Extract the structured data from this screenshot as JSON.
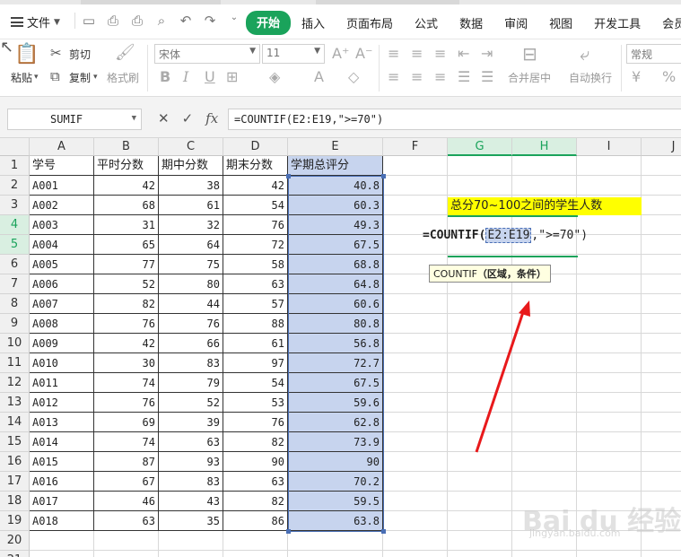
{
  "menubar": {
    "file_label": "文件",
    "tabs": [
      "开始",
      "插入",
      "页面布局",
      "公式",
      "数据",
      "审阅",
      "视图",
      "开发工具",
      "会员专"
    ],
    "active_tab": "开始"
  },
  "ribbon": {
    "paste_label": "粘贴",
    "cut_label": "剪切",
    "copy_label": "复制",
    "format_painter_label": "格式刷",
    "font_name": "宋体",
    "font_size": "11",
    "merge_label": "合并居中",
    "wrap_label": "自动换行",
    "number_format": "常规",
    "currency_symbol": "¥",
    "percent_symbol": "%"
  },
  "formula_bar": {
    "name_box": "SUMIF",
    "formula": "=COUNTIF(E2:E19,\">=70\")"
  },
  "columns": [
    "A",
    "B",
    "C",
    "D",
    "E",
    "F",
    "G",
    "H",
    "I",
    "J"
  ],
  "rows": [
    "1",
    "2",
    "3",
    "4",
    "5",
    "6",
    "7",
    "8",
    "9",
    "10",
    "11",
    "12",
    "13",
    "14",
    "15",
    "16",
    "17",
    "18",
    "19",
    "20",
    "21"
  ],
  "table": {
    "headers": [
      "学号",
      "平时分数",
      "期中分数",
      "期末分数",
      "学期总评分"
    ],
    "rows": [
      [
        "A001",
        "42",
        "38",
        "42",
        "40.8"
      ],
      [
        "A002",
        "68",
        "61",
        "54",
        "60.3"
      ],
      [
        "A003",
        "31",
        "32",
        "76",
        "49.3"
      ],
      [
        "A004",
        "65",
        "64",
        "72",
        "67.5"
      ],
      [
        "A005",
        "77",
        "75",
        "58",
        "68.8"
      ],
      [
        "A006",
        "52",
        "80",
        "63",
        "64.8"
      ],
      [
        "A007",
        "82",
        "44",
        "57",
        "60.6"
      ],
      [
        "A008",
        "76",
        "76",
        "88",
        "80.8"
      ],
      [
        "A009",
        "42",
        "66",
        "61",
        "56.8"
      ],
      [
        "A010",
        "30",
        "83",
        "97",
        "72.7"
      ],
      [
        "A011",
        "74",
        "79",
        "54",
        "67.5"
      ],
      [
        "A012",
        "76",
        "52",
        "53",
        "59.6"
      ],
      [
        "A013",
        "69",
        "39",
        "76",
        "62.8"
      ],
      [
        "A014",
        "74",
        "63",
        "82",
        "73.9"
      ],
      [
        "A015",
        "87",
        "93",
        "90",
        "90"
      ],
      [
        "A016",
        "67",
        "83",
        "63",
        "70.2"
      ],
      [
        "A017",
        "46",
        "43",
        "82",
        "59.5"
      ],
      [
        "A018",
        "63",
        "35",
        "86",
        "63.8"
      ]
    ]
  },
  "annotation": {
    "label": "总分70~100之间的学生人数",
    "edit_prefix": "=COUNTIF(",
    "edit_ref": "E2:E19",
    "edit_rest": ",\">=70\")",
    "tooltip_fn": "COUNTIF",
    "tooltip_args": "（区域，条件）"
  },
  "watermark": {
    "text": "Bai du 经验",
    "sub": "jingyan.baidu.com"
  },
  "colors": {
    "accent": "#1aa35b",
    "selection": "#c7d4ee",
    "highlight": "#ffff00",
    "arrow": "#e8191b"
  }
}
